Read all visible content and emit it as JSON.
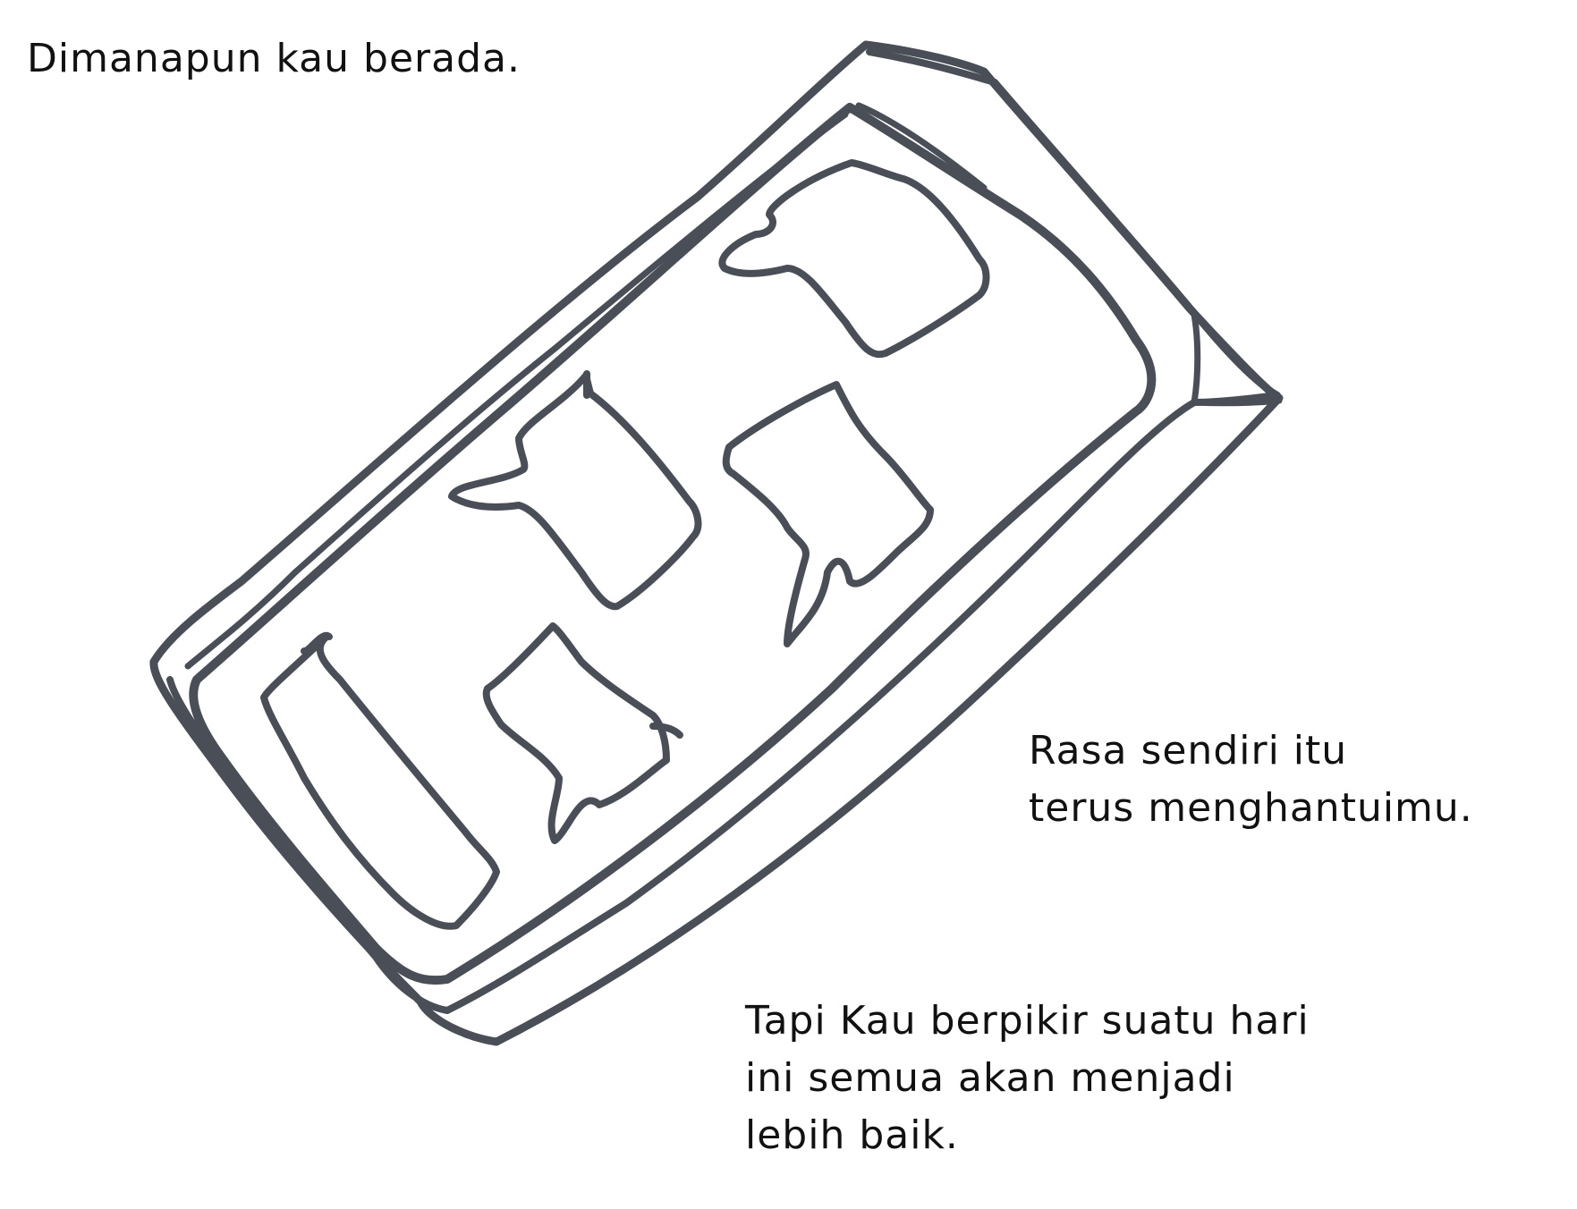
{
  "captions": {
    "top": {
      "line1": "Dimanapun kau berada."
    },
    "middle": {
      "line1": "Rasa sendiri itu",
      "line2": "terus menghantuimu."
    },
    "bottom": {
      "line1": "Tapi Kau berpikir suatu hari",
      "line2": "ini semua akan menjadi",
      "line3": "lebih baik."
    }
  },
  "colors": {
    "ink": "#4a4f57",
    "text": "#111111",
    "background": "#ffffff"
  },
  "icons": [
    "phone-sketch",
    "speech-bubble-icon"
  ]
}
